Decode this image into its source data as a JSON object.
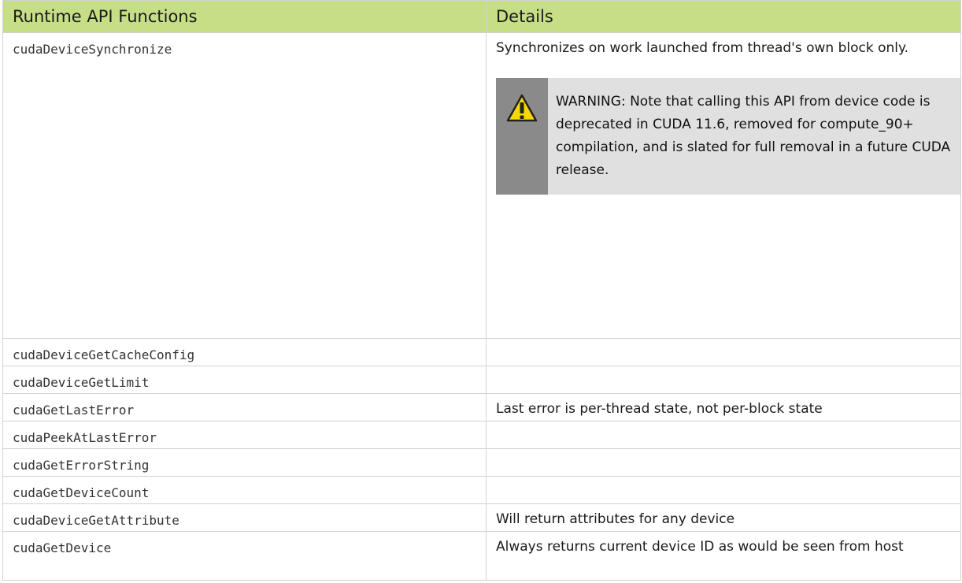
{
  "header": {
    "col1": "Runtime API Functions",
    "col2": "Details"
  },
  "rows": [
    {
      "fn": "cudaDeviceSynchronize",
      "detail": "Synchronizes on work launched from thread's own block only.",
      "warning": "WARNING: Note that calling this API from device code is deprecated in CUDA 11.6, removed for compute_90+ compilation, and is slated for full removal in a future CUDA release."
    },
    {
      "fn": "cudaDeviceGetCacheConfig",
      "detail": ""
    },
    {
      "fn": "cudaDeviceGetLimit",
      "detail": ""
    },
    {
      "fn": "cudaGetLastError",
      "detail": "Last error is per-thread state, not per-block state"
    },
    {
      "fn": "cudaPeekAtLastError",
      "detail": ""
    },
    {
      "fn": "cudaGetErrorString",
      "detail": ""
    },
    {
      "fn": "cudaGetDeviceCount",
      "detail": ""
    },
    {
      "fn": "cudaDeviceGetAttribute",
      "detail": "Will return attributes for any device"
    },
    {
      "fn": "cudaGetDevice",
      "detail": "Always returns current device ID as would be seen from host"
    }
  ],
  "colors": {
    "header_bg": "#c6de86",
    "warning_bg": "#e0e0e0",
    "warning_bar": "#8a8a8a",
    "warning_icon": "#f5d800"
  },
  "icons": {
    "warning": "warning-triangle-icon"
  }
}
